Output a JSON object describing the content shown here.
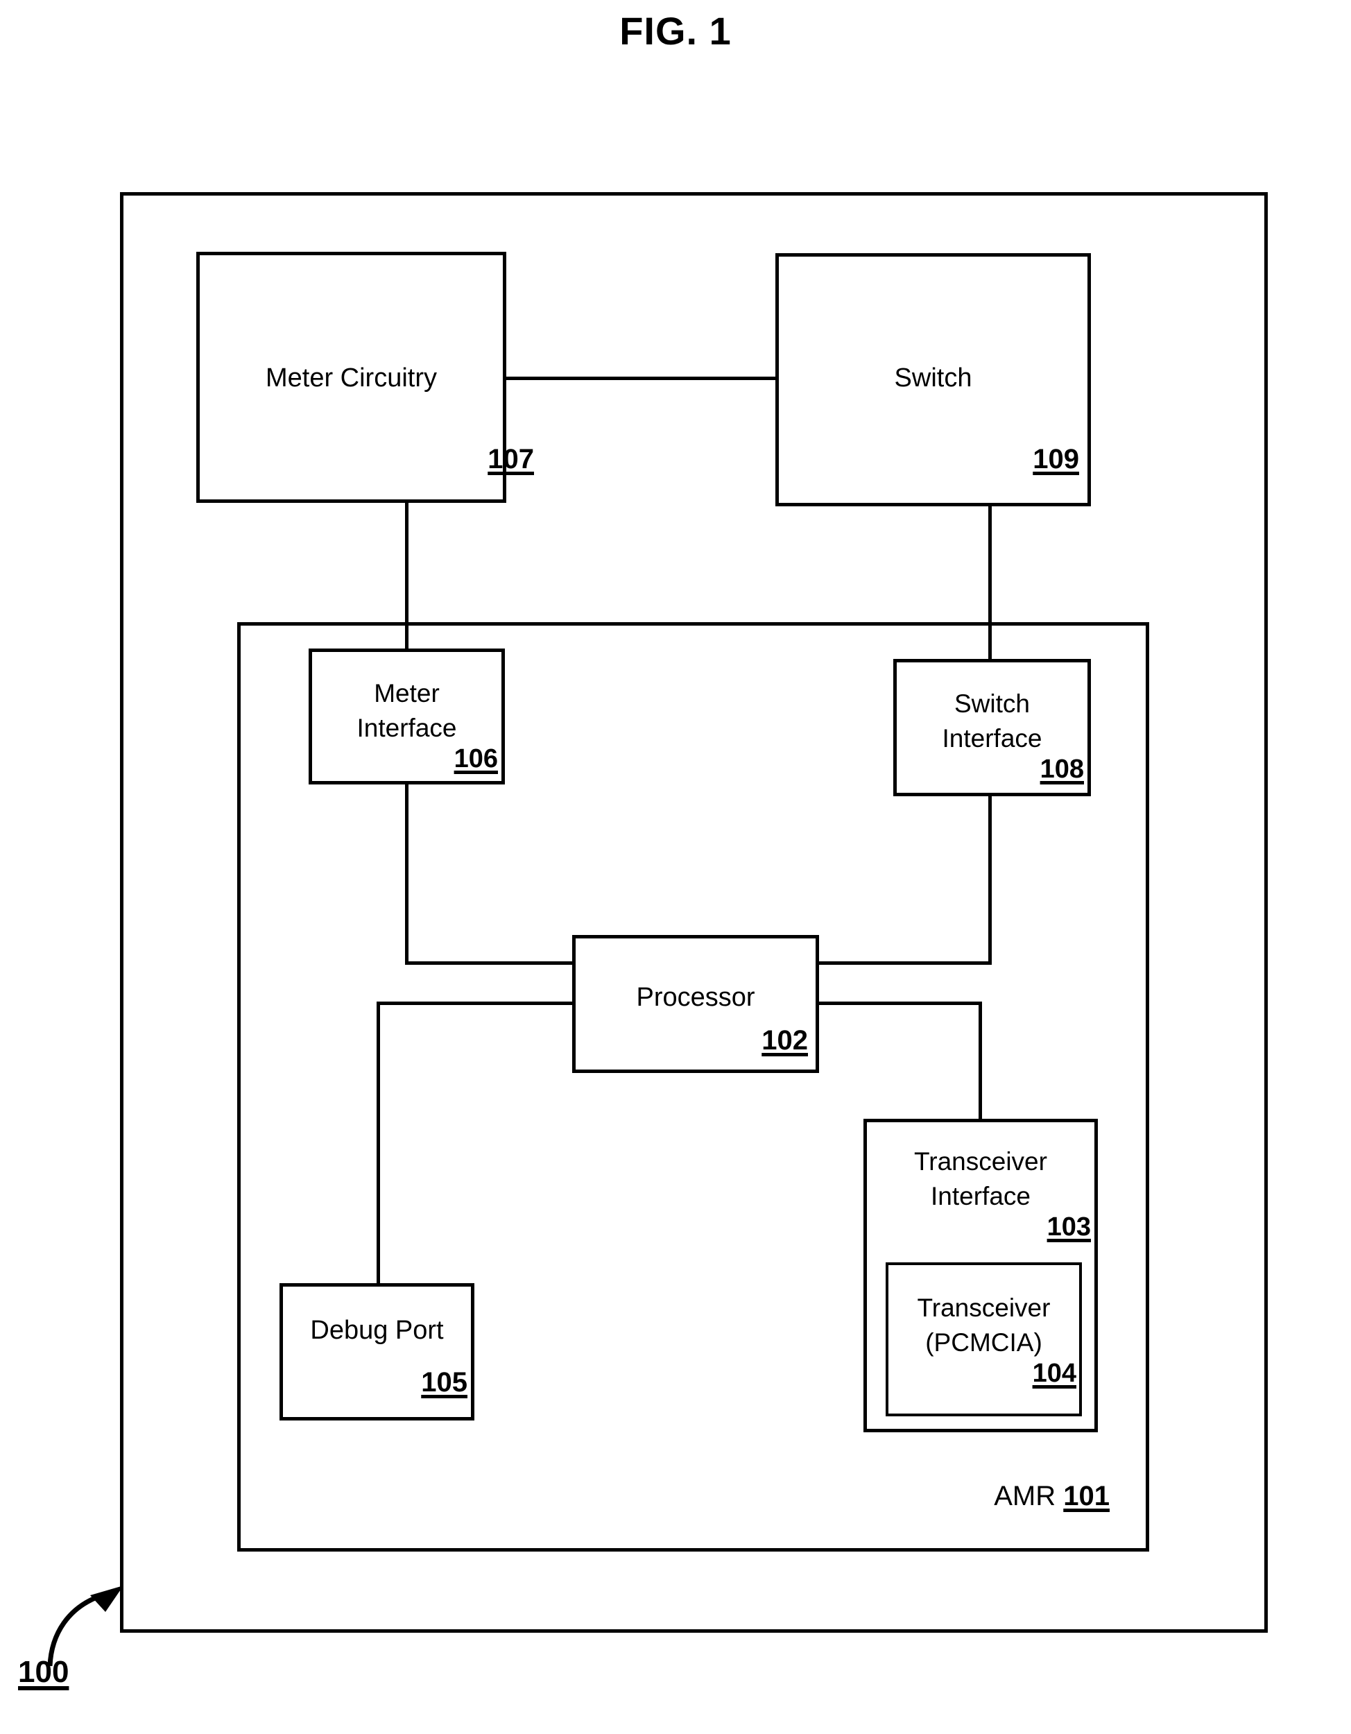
{
  "figure": {
    "title": "FIG. 1",
    "system_ref": "100"
  },
  "blocks": {
    "meter_circuitry": {
      "label": "Meter Circuitry",
      "ref": "107"
    },
    "switch": {
      "label": "Switch",
      "ref": "109"
    },
    "meter_interface": {
      "label": "Meter\nInterface",
      "ref": "106"
    },
    "switch_interface": {
      "label": "Switch\nInterface",
      "ref": "108"
    },
    "processor": {
      "label": "Processor",
      "ref": "102"
    },
    "transceiver_interface": {
      "label": "Transceiver\nInterface",
      "ref": "103"
    },
    "transceiver": {
      "label": "Transceiver\n(PCMCIA)",
      "ref": "104"
    },
    "debug_port": {
      "label": "Debug Port",
      "ref": "105"
    },
    "amr": {
      "label": "AMR",
      "ref": "101"
    }
  },
  "chart_data": {
    "type": "diagram",
    "title": "FIG. 1",
    "nodes": [
      {
        "id": "107",
        "label": "Meter Circuitry",
        "container": "outer"
      },
      {
        "id": "109",
        "label": "Switch",
        "container": "outer"
      },
      {
        "id": "101",
        "label": "AMR",
        "container": "outer"
      },
      {
        "id": "106",
        "label": "Meter Interface",
        "container": "AMR"
      },
      {
        "id": "108",
        "label": "Switch Interface",
        "container": "AMR"
      },
      {
        "id": "102",
        "label": "Processor",
        "container": "AMR"
      },
      {
        "id": "105",
        "label": "Debug Port",
        "container": "AMR"
      },
      {
        "id": "103",
        "label": "Transceiver Interface",
        "container": "AMR"
      },
      {
        "id": "104",
        "label": "Transceiver (PCMCIA)",
        "container": "103"
      }
    ],
    "edges": [
      {
        "from": "107",
        "to": "109"
      },
      {
        "from": "107",
        "to": "106"
      },
      {
        "from": "109",
        "to": "108"
      },
      {
        "from": "106",
        "to": "102"
      },
      {
        "from": "108",
        "to": "102"
      },
      {
        "from": "102",
        "to": "105"
      },
      {
        "from": "102",
        "to": "103"
      }
    ]
  }
}
